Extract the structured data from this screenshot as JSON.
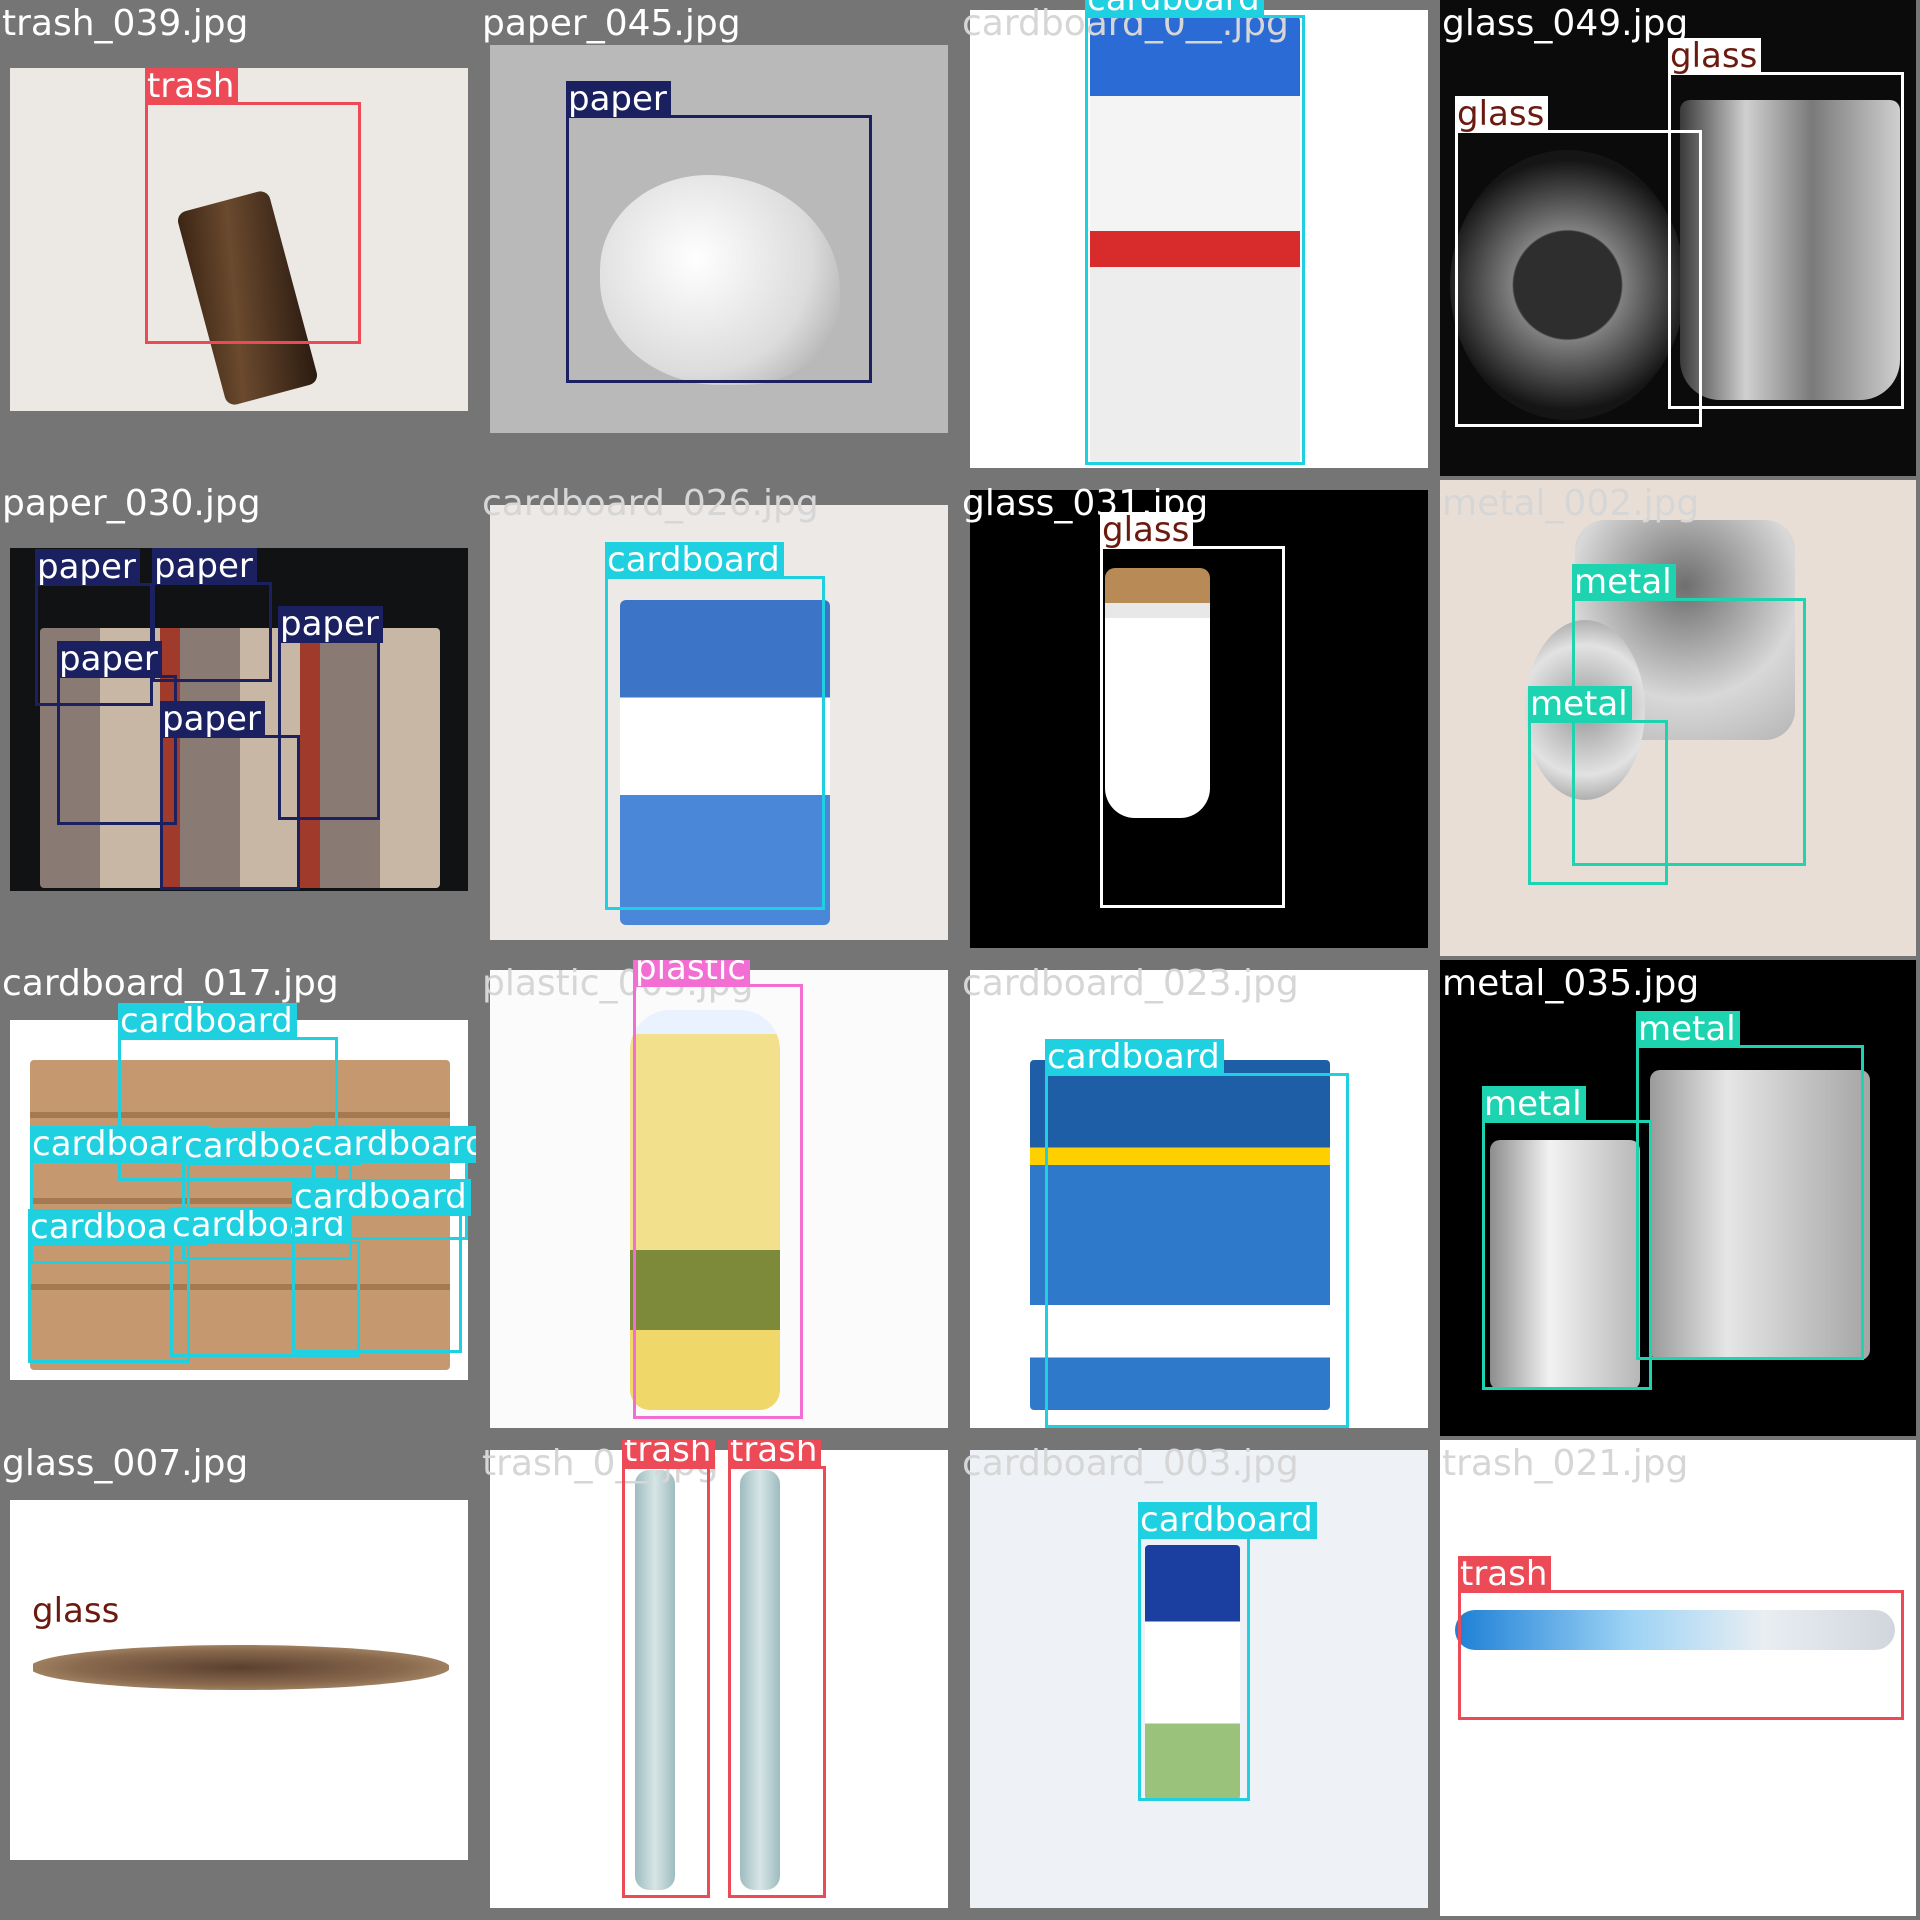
{
  "classes": {
    "trash": {
      "color": "#ec4a56",
      "text": "#ffffff"
    },
    "paper": {
      "color": "#1a2060",
      "text": "#ffffff"
    },
    "cardboard": {
      "color": "#1fd0e0",
      "text": "#ffffff"
    },
    "glass": {
      "color": "#ffffff",
      "text": "#6b1a10"
    },
    "metal": {
      "color": "#1ed3b0",
      "text": "#ffffff"
    },
    "plastic": {
      "color": "#f26ed2",
      "text": "#ffffff"
    }
  },
  "tiles": [
    {
      "file": "trash_039.jpg",
      "detections": [
        "trash"
      ]
    },
    {
      "file": "paper_045.jpg",
      "detections": [
        "paper"
      ]
    },
    {
      "file": "cardboard_0__.jpg",
      "detections": [
        "cardboard"
      ]
    },
    {
      "file": "glass_049.jpg",
      "detections": [
        "glass",
        "glass"
      ]
    },
    {
      "file": "paper_030.jpg",
      "detections": [
        "paper",
        "paper",
        "paper",
        "paper",
        "paper"
      ]
    },
    {
      "file": "cardboard_026.jpg",
      "detections": [
        "cardboard"
      ]
    },
    {
      "file": "glass_031.jpg",
      "detections": [
        "glass"
      ]
    },
    {
      "file": "metal_002.jpg",
      "detections": [
        "metal",
        "metal"
      ]
    },
    {
      "file": "cardboard_017.jpg",
      "detections": [
        "cardboard",
        "cardboard",
        "cardboard",
        "cardboard",
        "cardboard",
        "cardboard",
        "cardboard"
      ]
    },
    {
      "file": "plastic_003.jpg",
      "detections": [
        "plastic"
      ]
    },
    {
      "file": "cardboard_023.jpg",
      "detections": [
        "cardboard"
      ]
    },
    {
      "file": "metal_035.jpg",
      "detections": [
        "metal",
        "metal"
      ]
    },
    {
      "file": "glass_007.jpg",
      "detections": [
        "glass"
      ]
    },
    {
      "file": "trash_0__.jpg",
      "detections": [
        "trash",
        "trash"
      ]
    },
    {
      "file": "cardboard_003.jpg",
      "detections": [
        "cardboard"
      ]
    },
    {
      "file": "trash_021.jpg",
      "detections": [
        "trash"
      ]
    }
  ]
}
